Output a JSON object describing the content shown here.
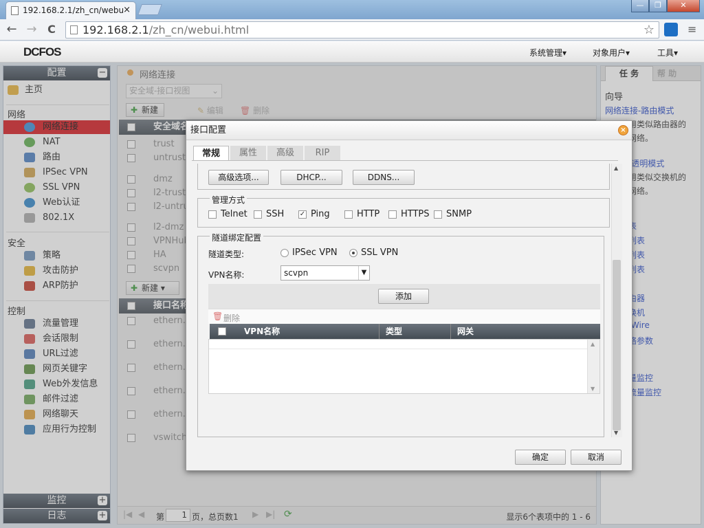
{
  "browser": {
    "tab_title": "192.168.2.1/zh_cn/webu",
    "tab_close": "×",
    "url_host": "192.168.2.1",
    "url_path": "/zh_cn/webui.html",
    "back": "←",
    "forward": "→",
    "reload": "C",
    "minimize": "—",
    "maximize": "❐",
    "close": "✕"
  },
  "header": {
    "logo": "DCFOS",
    "menus": [
      "系统管理▾",
      "对象用户▾",
      "工具▾"
    ]
  },
  "sidebar": {
    "title": "配置",
    "collapse": "−",
    "home": "主页",
    "sections": {
      "network": "网络",
      "security": "安全",
      "control": "控制"
    },
    "network_items": [
      "网络连接",
      "NAT",
      "路由",
      "IPSec VPN",
      "SSL VPN",
      "Web认证",
      "802.1X"
    ],
    "security_items": [
      "策略",
      "攻击防护",
      "ARP防护"
    ],
    "control_items": [
      "流量管理",
      "会话限制",
      "URL过滤",
      "网页关键字",
      "Web外发信息",
      "邮件过滤",
      "网络聊天",
      "应用行为控制"
    ],
    "monitor": "监控",
    "log": "日志",
    "expand": "+"
  },
  "center": {
    "breadcrumb": "网络连接",
    "view_select": "安全域-接口视图",
    "btn_new": "新建",
    "btn_edit": "编辑",
    "btn_delete": "删除",
    "zone_header": "安全域名",
    "zones": [
      "trust",
      "untrust",
      "dmz",
      "l2-trust",
      "l2-untru",
      "l2-dmz",
      "VPNHub",
      "HA",
      "scvpn"
    ],
    "iface_header": "接口名称",
    "ifaces": [
      "ethern..",
      "ethern..",
      "ethern..",
      "ethern..",
      "ethern..",
      "vswitch"
    ],
    "pager_page_label": "第",
    "pager_page": "1",
    "pager_total": "页，总页数1",
    "pager_info": "显示6个表项中的 1 - 6"
  },
  "right": {
    "tab_task": "任 务",
    "tab_help": "帮 助",
    "guide": "向导",
    "links": [
      "网络连接-路由模式",
      "采用类似路由器的",
      "入网络。",
      "务-透明模式",
      "采用类似交换机的",
      "入网络。",
      "表",
      "列表",
      "列表",
      "列表",
      "由器",
      "换机",
      "-Wire",
      "络参数",
      "量监控",
      "流量监控"
    ]
  },
  "dialog": {
    "title": "接口配置",
    "close": "×",
    "tabs": [
      "常规",
      "属性",
      "高级",
      "RIP"
    ],
    "btn_advanced": "高级选项...",
    "btn_dhcp": "DHCP...",
    "btn_ddns": "DDNS...",
    "mgmt_legend": "管理方式",
    "mgmt": [
      {
        "label": "Telnet",
        "checked": false
      },
      {
        "label": "SSH",
        "checked": false
      },
      {
        "label": "Ping",
        "checked": true
      },
      {
        "label": "HTTP",
        "checked": false
      },
      {
        "label": "HTTPS",
        "checked": false
      },
      {
        "label": "SNMP",
        "checked": false
      }
    ],
    "tunnel_legend": "隧道绑定配置",
    "tunnel_type_label": "隧道类型:",
    "tunnel_opt1": "IPSec VPN",
    "tunnel_opt2": "SSL VPN",
    "tunnel_selected": "SSL VPN",
    "vpn_name_label": "VPN名称:",
    "vpn_name_value": "scvpn",
    "btn_add": "添加",
    "btn_del": "删除",
    "cols": [
      "VPN名称",
      "类型",
      "网关"
    ],
    "btn_ok": "确定",
    "btn_cancel": "取消"
  },
  "colors": {
    "selected": "#d7171e",
    "header_dark": "#3a434d",
    "link": "#2447c7"
  }
}
